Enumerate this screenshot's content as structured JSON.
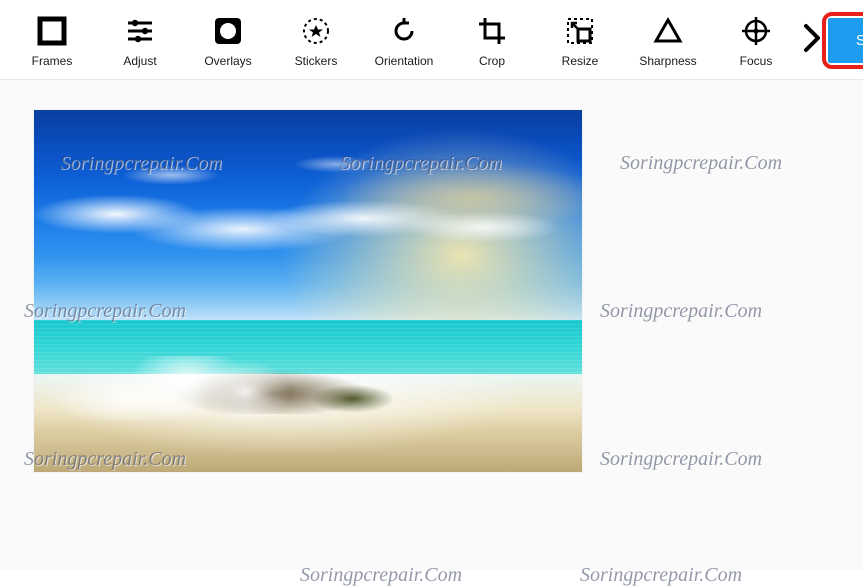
{
  "toolbar": {
    "tools": [
      {
        "key": "frames",
        "label": "Frames",
        "icon": "frames-icon"
      },
      {
        "key": "adjust",
        "label": "Adjust",
        "icon": "adjust-icon"
      },
      {
        "key": "overlays",
        "label": "Overlays",
        "icon": "overlays-icon"
      },
      {
        "key": "stickers",
        "label": "Stickers",
        "icon": "stickers-icon"
      },
      {
        "key": "orientation",
        "label": "Orientation",
        "icon": "orientation-icon"
      },
      {
        "key": "crop",
        "label": "Crop",
        "icon": "crop-icon"
      },
      {
        "key": "resize",
        "label": "Resize",
        "icon": "resize-icon"
      },
      {
        "key": "sharpness",
        "label": "Sharpness",
        "icon": "sharpness-icon"
      },
      {
        "key": "focus",
        "label": "Focus",
        "icon": "focus-icon"
      }
    ],
    "next_icon": "chevron-right-icon",
    "save_label": "Save"
  },
  "watermark_text": "Soringpcrepair.Com",
  "colors": {
    "accent": "#1e9cf0",
    "highlight_border": "#e8201a",
    "toolbar_border": "#e9e9ea",
    "canvas_bg": "#fafafa"
  }
}
